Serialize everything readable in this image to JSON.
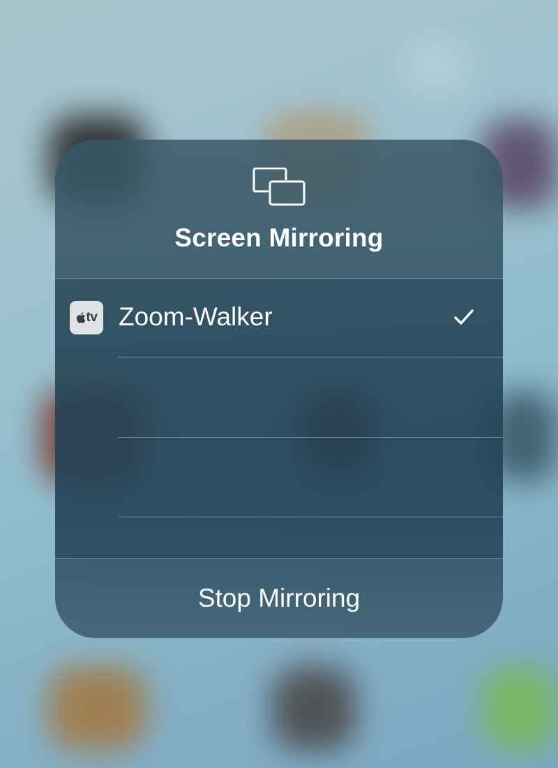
{
  "sheet": {
    "title": "Screen Mirroring",
    "icon": "screen-mirroring-icon"
  },
  "devices": [
    {
      "badge_text": "tv",
      "badge_icon": "apple-logo-icon",
      "name": "Zoom-Walker",
      "selected": true,
      "status_icon": "checkmark-icon"
    }
  ],
  "stop_button": {
    "label": "Stop Mirroring"
  },
  "colors": {
    "sheet_tint": "#2e5466",
    "text": "#ffffff",
    "divider": "#a0c3d2",
    "badge_bg": "#dfe3e6"
  }
}
